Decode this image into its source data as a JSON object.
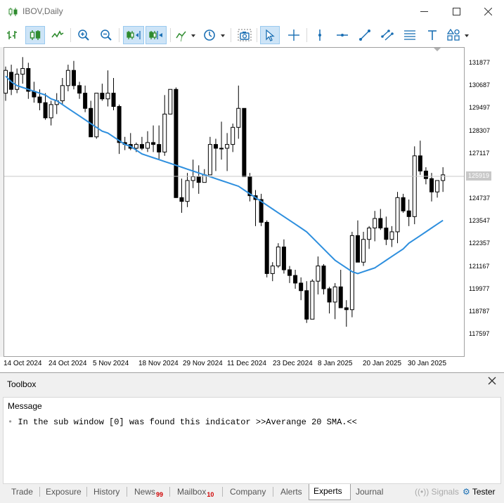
{
  "window": {
    "title": "IBOV,Daily",
    "controls": {
      "minimize": "minimize",
      "maximize": "maximize",
      "close": "close"
    }
  },
  "toolbar": {
    "buttons": [
      {
        "name": "bar-chart-icon",
        "active": false
      },
      {
        "name": "candlestick-icon",
        "active": true
      },
      {
        "name": "line-chart-icon",
        "active": false
      },
      {
        "name": "zoom-in-icon",
        "active": false
      },
      {
        "name": "zoom-out-icon",
        "active": false
      },
      {
        "name": "auto-scroll-icon",
        "active": true
      },
      {
        "name": "chart-shift-icon",
        "active": true
      },
      {
        "name": "indicators-icon",
        "active": false
      },
      {
        "name": "timeframes-icon",
        "active": false
      },
      {
        "name": "screenshot-icon",
        "active": false
      },
      {
        "name": "cursor-icon",
        "active": true
      },
      {
        "name": "crosshair-icon",
        "active": false
      },
      {
        "name": "vertical-line-icon",
        "active": false
      },
      {
        "name": "horizontal-line-icon",
        "active": false
      },
      {
        "name": "trendline-icon",
        "active": false
      },
      {
        "name": "equidistant-channel-icon",
        "active": false
      },
      {
        "name": "fibonacci-icon",
        "active": false
      },
      {
        "name": "text-icon",
        "active": false
      },
      {
        "name": "shapes-icon",
        "active": false
      }
    ]
  },
  "chart_data": {
    "type": "candlestick",
    "symbol": "IBOV",
    "timeframe": "Daily",
    "ylim": [
      116600,
      132900
    ],
    "y_ticks": [
      "131877",
      "130687",
      "129497",
      "128307",
      "127117",
      "125927",
      "124737",
      "123547",
      "122357",
      "121167",
      "119977",
      "118787",
      "117597"
    ],
    "x_ticks": [
      "14 Oct 2024",
      "24 Oct 2024",
      "5 Nov 2024",
      "18 Nov 2024",
      "29 Nov 2024",
      "11 Dec 2024",
      "23 Dec 2024",
      "8 Jan 2025",
      "20 Jan 2025",
      "30 Jan 2025"
    ],
    "current_price_label": "125919",
    "current_price": 125919,
    "grid": false,
    "bull_color": "#ffffff",
    "bear_color": "#000000",
    "candles": [
      [
        130300,
        131700,
        129900,
        131500
      ],
      [
        131400,
        131800,
        130200,
        130500
      ],
      [
        130500,
        131600,
        130300,
        131300
      ],
      [
        131300,
        132200,
        130800,
        131600
      ],
      [
        131600,
        131900,
        130000,
        130400
      ],
      [
        130400,
        130900,
        129800,
        130100
      ],
      [
        130100,
        130500,
        129400,
        129800
      ],
      [
        129800,
        130300,
        128900,
        129000
      ],
      [
        129000,
        129900,
        128600,
        129700
      ],
      [
        129700,
        130300,
        129200,
        129900
      ],
      [
        129900,
        131100,
        129700,
        130700
      ],
      [
        130700,
        131800,
        130400,
        131500
      ],
      [
        131500,
        132000,
        130500,
        130700
      ],
      [
        130700,
        130900,
        130000,
        130300
      ],
      [
        130300,
        130700,
        129300,
        129500
      ],
      [
        129500,
        129900,
        128000,
        128000
      ],
      [
        128000,
        130300,
        127900,
        130300
      ],
      [
        130300,
        130800,
        129900,
        130000
      ],
      [
        130000,
        131500,
        129600,
        130300
      ],
      [
        130300,
        131100,
        129400,
        129600
      ],
      [
        129600,
        129700,
        127100,
        127700
      ],
      [
        127700,
        128000,
        127300,
        127600
      ],
      [
        127600,
        128200,
        127300,
        127400
      ],
      [
        127400,
        127700,
        127200,
        127600
      ],
      [
        127600,
        128000,
        127300,
        127400
      ],
      [
        127400,
        128300,
        127200,
        127700
      ],
      [
        127700,
        128600,
        127200,
        127600
      ],
      [
        127600,
        128600,
        126800,
        127200
      ],
      [
        127200,
        130200,
        127000,
        129200
      ],
      [
        129200,
        130500,
        129200,
        130500
      ],
      [
        130500,
        130600,
        125000,
        124800
      ],
      [
        124800,
        125800,
        124000,
        124600
      ],
      [
        124600,
        126100,
        124300,
        125700
      ],
      [
        125700,
        126800,
        125300,
        125900
      ],
      [
        125900,
        126500,
        125000,
        125600
      ],
      [
        125600,
        126300,
        125700,
        126000
      ],
      [
        126000,
        128000,
        126300,
        127600
      ],
      [
        127600,
        127900,
        126200,
        127400
      ],
      [
        127400,
        128800,
        126800,
        127400
      ],
      [
        127400,
        128200,
        126200,
        127600
      ],
      [
        127600,
        128700,
        127200,
        128500
      ],
      [
        128500,
        130700,
        127900,
        129500
      ],
      [
        129500,
        129500,
        125900,
        125900
      ],
      [
        125900,
        126100,
        124600,
        124900
      ],
      [
        124900,
        125200,
        123300,
        124700
      ],
      [
        124700,
        125000,
        123300,
        123500
      ],
      [
        123500,
        123600,
        120600,
        120800
      ],
      [
        120800,
        121400,
        120400,
        121200
      ],
      [
        121200,
        122400,
        121100,
        122200
      ],
      [
        122200,
        122600,
        120800,
        121000
      ],
      [
        121000,
        121200,
        120300,
        120700
      ],
      [
        120700,
        121000,
        120000,
        120300
      ],
      [
        120300,
        120600,
        119400,
        119900
      ],
      [
        119900,
        120400,
        118200,
        118400
      ],
      [
        118400,
        120500,
        118500,
        120400
      ],
      [
        120400,
        121700,
        119700,
        121200
      ],
      [
        121200,
        121300,
        119700,
        120000
      ],
      [
        120000,
        120100,
        118700,
        119300
      ],
      [
        119300,
        120300,
        118400,
        120100
      ],
      [
        120100,
        121000,
        119000,
        119000
      ],
      [
        119000,
        119400,
        118000,
        118900
      ],
      [
        118900,
        123000,
        118500,
        122800
      ],
      [
        122800,
        123600,
        121400,
        121400
      ],
      [
        121400,
        123000,
        121200,
        122600
      ],
      [
        122600,
        123300,
        122100,
        123200
      ],
      [
        123200,
        124100,
        122500,
        123700
      ],
      [
        123700,
        124200,
        123100,
        123200
      ],
      [
        123200,
        123800,
        122300,
        122600
      ],
      [
        122600,
        123300,
        122200,
        123000
      ],
      [
        123000,
        125100,
        122400,
        124800
      ],
      [
        124800,
        125000,
        124000,
        124100
      ],
      [
        124100,
        124700,
        123300,
        123800
      ],
      [
        123800,
        127500,
        123400,
        127000
      ],
      [
        127000,
        127800,
        126000,
        126200
      ],
      [
        126200,
        126400,
        125500,
        125800
      ],
      [
        125800,
        126100,
        124600,
        125100
      ],
      [
        125100,
        125600,
        124800,
        125700
      ],
      [
        125700,
        126400,
        125100,
        126000
      ]
    ],
    "sma": {
      "name": "Averange 20 SMA",
      "color": "#2e8fde",
      "values": [
        131200,
        130900,
        130700,
        130600,
        130500,
        130400,
        130300,
        130200,
        130000,
        129900,
        129700,
        129500,
        129300,
        129100,
        128900,
        128700,
        128500,
        128300,
        128200,
        128000,
        127800,
        127600,
        127500,
        127300,
        127100,
        127000,
        126900,
        126800,
        126700,
        126600,
        126500,
        126400,
        126300,
        126200,
        126100,
        126000,
        125900,
        125800,
        125700,
        125600,
        125500,
        125400,
        125200,
        125000,
        124800,
        124600,
        124400,
        124200,
        124000,
        123800,
        123600,
        123400,
        123200,
        123000,
        122700,
        122400,
        122100,
        121800,
        121500,
        121300,
        121100,
        120900,
        120800,
        120900,
        121000,
        121100,
        121300,
        121500,
        121700,
        121900,
        122100,
        122400,
        122600,
        122800,
        123000,
        123200,
        123400,
        123600
      ]
    }
  },
  "toolbox": {
    "title": "Toolbox",
    "column_header": "Message",
    "messages": [
      "In the sub window [0] was found this indicator >>Averange 20 SMA.<<"
    ],
    "tabs": [
      {
        "label": "Trade",
        "badge": ""
      },
      {
        "label": "Exposure",
        "badge": ""
      },
      {
        "label": "History",
        "badge": ""
      },
      {
        "label": "News",
        "badge": "99"
      },
      {
        "label": "Mailbox",
        "badge": "10"
      },
      {
        "label": "Company",
        "badge": ""
      },
      {
        "label": "Alerts",
        "badge": ""
      },
      {
        "label": "Experts",
        "badge": "",
        "active": true
      },
      {
        "label": "Journal",
        "badge": ""
      }
    ],
    "signals_label": "Signals",
    "tester_label": "Tester"
  }
}
